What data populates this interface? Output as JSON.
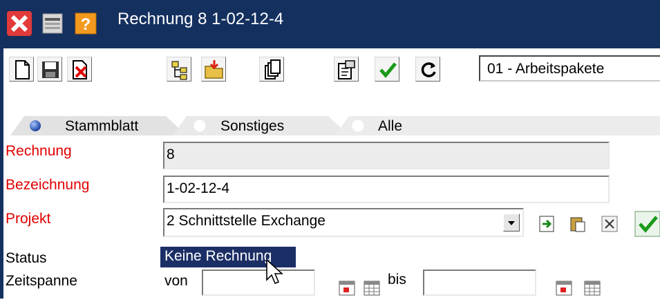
{
  "window": {
    "title": "Rechnung 8 1-02-12-4"
  },
  "toolbar": {
    "buttons": [
      "new-document-icon",
      "save-icon",
      "delete-icon",
      "tree-icon",
      "open-folder-icon",
      "copy-icon",
      "properties-icon",
      "check-icon",
      "refresh-icon"
    ],
    "view_select_value": "01 - Arbeitspakete"
  },
  "tabs": [
    {
      "label": "Stammblatt",
      "active": true
    },
    {
      "label": "Sonstiges",
      "active": false
    },
    {
      "label": "Alle",
      "active": false
    }
  ],
  "form": {
    "rechnung": {
      "label": "Rechnung",
      "value": "8"
    },
    "bezeichnung": {
      "label": "Bezeichnung",
      "value": "1-02-12-4"
    },
    "projekt": {
      "label": "Projekt",
      "value": "2 Schnittstelle Exchange"
    },
    "status": {
      "label": "Status",
      "value": "Keine Rechnung"
    },
    "zeitspanne": {
      "label": "Zeitspanne",
      "from_label": "von",
      "from_value": "",
      "to_label": "bis",
      "to_value": ""
    }
  },
  "colors": {
    "titlebar": "#14305f",
    "required_label": "#e00000",
    "status_highlight": "#1b2f66",
    "readonly_field": "#ececec"
  }
}
